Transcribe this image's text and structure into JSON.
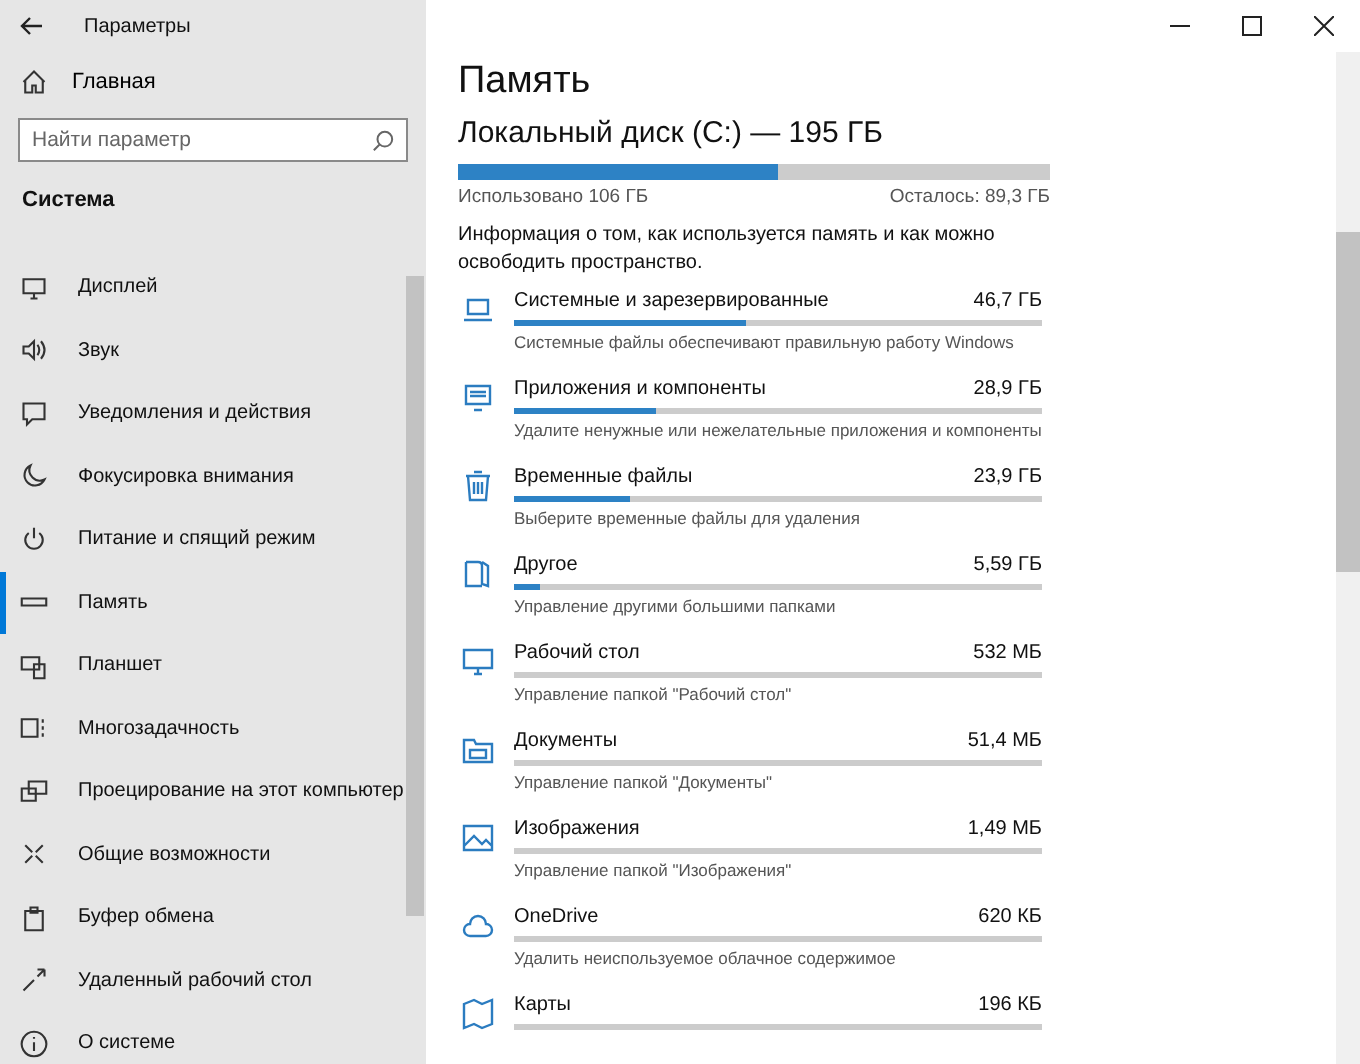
{
  "window": {
    "title": "Параметры"
  },
  "sidebar": {
    "home": "Главная",
    "search": {
      "placeholder": "Найти параметр"
    },
    "section": "Система",
    "items": [
      {
        "label": "Дисплей",
        "selected": false
      },
      {
        "label": "Звук",
        "selected": false
      },
      {
        "label": "Уведомления и действия",
        "selected": false
      },
      {
        "label": "Фокусировка внимания",
        "selected": false
      },
      {
        "label": "Питание и спящий режим",
        "selected": false
      },
      {
        "label": "Память",
        "selected": true
      },
      {
        "label": "Планшет",
        "selected": false
      },
      {
        "label": "Многозадачность",
        "selected": false
      },
      {
        "label": "Проецирование на этот компьютер",
        "selected": false
      },
      {
        "label": "Общие возможности",
        "selected": false
      },
      {
        "label": "Буфер обмена",
        "selected": false
      },
      {
        "label": "Удаленный рабочий стол",
        "selected": false
      },
      {
        "label": "О системе",
        "selected": false
      }
    ]
  },
  "main": {
    "title": "Память",
    "disk": {
      "title": "Локальный диск (C:) — 195 ГБ",
      "level": 0.54,
      "used": "Использовано 106 ГБ",
      "free": "Осталось: 89,3 ГБ"
    },
    "info": "Информация о том, как используется память и как можно освободить пространство.",
    "categories": [
      {
        "name": "Системные и зарезервированные",
        "size": "46,7 ГБ",
        "level": 0.44,
        "description": "Системные файлы обеспечивают правильную работу Windows"
      },
      {
        "name": "Приложения и компоненты",
        "size": "28,9 ГБ",
        "level": 0.27,
        "description": "Удалите ненужные или нежелательные приложения и компоненты"
      },
      {
        "name": "Временные файлы",
        "size": "23,9 ГБ",
        "level": 0.22,
        "description": "Выберите временные файлы для удаления"
      },
      {
        "name": "Другое",
        "size": "5,59 ГБ",
        "level": 0.05,
        "description": "Управление другими большими папками"
      },
      {
        "name": "Рабочий стол",
        "size": "532 МБ",
        "description": "Управление папкой \"Рабочий стол\""
      },
      {
        "name": "Документы",
        "size": "51,4 МБ",
        "description": "Управление папкой \"Документы\""
      },
      {
        "name": "Изображения",
        "size": "1,49 МБ",
        "description": "Управление папкой \"Изображения\""
      },
      {
        "name": "OneDrive",
        "size": "620 КБ",
        "description": "Удалить неиспользуемое облачное содержимое"
      },
      {
        "name": "Карты",
        "size": "196 КБ"
      }
    ]
  }
}
